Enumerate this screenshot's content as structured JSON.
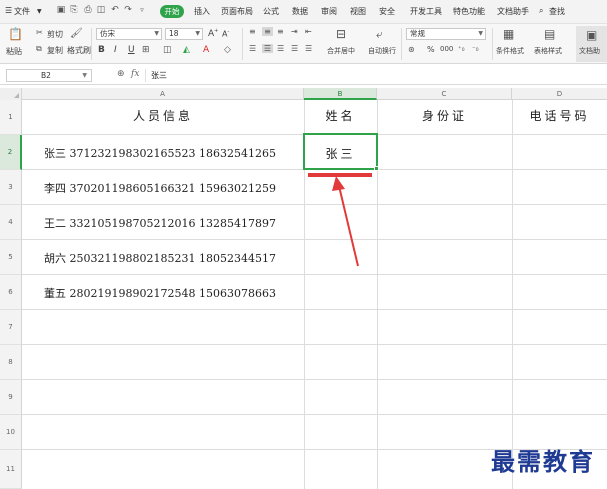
{
  "menubar": {
    "file_label": "文件",
    "tabs": [
      "开始",
      "插入",
      "页面布局",
      "公式",
      "数据",
      "审阅",
      "视图",
      "安全",
      "开发工具",
      "特色功能",
      "文档助手"
    ],
    "search_label": "查找"
  },
  "ribbon": {
    "paste_label": "粘贴",
    "cut_label": "剪切",
    "copy_label": "复制",
    "format_painter_label": "格式刷",
    "font_name": "仿宋",
    "font_size": "18",
    "number_format": "常规",
    "merge_label": "合并居中",
    "wrap_label": "自动换行",
    "cond_format_label": "条件格式",
    "table_style_label": "表格样式",
    "doc_assist_label": "文档助",
    "font_inc": "A",
    "font_dec": "A",
    "bold": "B",
    "italic": "I",
    "underline": "U",
    "percent": "%",
    "thousands": "000",
    "accent_color": "#2ea34a"
  },
  "formula_bar": {
    "cell_ref": "B2",
    "fx_label": "fx",
    "value": "张三"
  },
  "columns": [
    "A",
    "B",
    "C",
    "D"
  ],
  "rows": [
    "1",
    "2",
    "3",
    "4",
    "5",
    "6",
    "7",
    "8",
    "9",
    "10",
    "11"
  ],
  "selected_cell": "B2",
  "sheet": {
    "headers": [
      "人员信息",
      "姓名",
      "身份证",
      "电话号码"
    ],
    "people": [
      "张三  371232198302165523  18632541265",
      "李四  370201198605166321  15963021259",
      "王二  332105198705212016  13285417897",
      "胡六  250321198802185231  18052344517",
      "董五  280219198902172548  15063078663"
    ],
    "b2": "张三"
  },
  "annotation": {
    "color": "#e23a3a"
  },
  "watermark": "最需教育"
}
